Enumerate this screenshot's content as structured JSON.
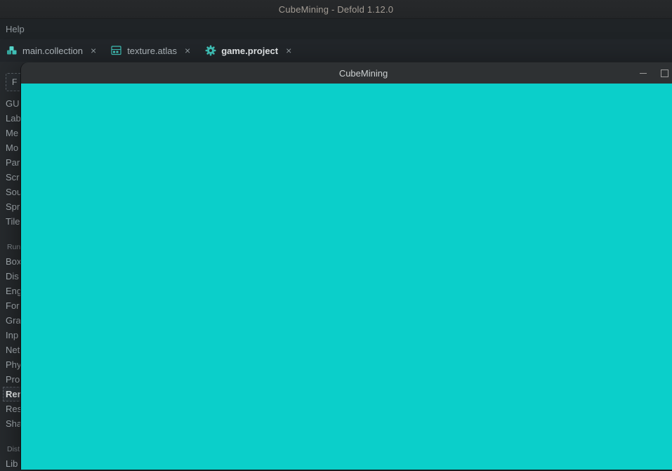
{
  "titlebar": {
    "title": "CubeMining - Defold 1.12.0"
  },
  "menubar": {
    "items": [
      {
        "label": "Help"
      }
    ]
  },
  "tabbar": {
    "tabs": [
      {
        "label": "main.collection",
        "icon": "collection-icon",
        "close_glyph": "×",
        "active": false
      },
      {
        "label": "texture.atlas",
        "icon": "atlas-icon",
        "close_glyph": "×",
        "active": false
      },
      {
        "label": "game.project",
        "icon": "gear-icon",
        "close_glyph": "×",
        "active": true
      }
    ]
  },
  "sidebar": {
    "filter_text": "F",
    "groups": [
      {
        "header": null,
        "selected_index": -1,
        "items": [
          "GU",
          "Lab",
          "Me",
          "Mo",
          "Par",
          "Scr",
          "Sou",
          "Spr",
          "Tile"
        ]
      },
      {
        "header": "Run",
        "selected_index": 9,
        "items": [
          "Box",
          "Dis",
          "Eng",
          "For",
          "Gra",
          "Inp",
          "Net",
          "Phy",
          "Pro",
          "Ren",
          "Res",
          "Sha"
        ]
      },
      {
        "header": "Dist",
        "selected_index": -1,
        "items": [
          "Lib"
        ]
      }
    ]
  },
  "game_window": {
    "title": "CubeMining"
  },
  "colors": {
    "accent_teal": "#41c4ba",
    "game_view": "#0bcfca",
    "game_view_bottom_edge": "#15b9b5",
    "editor_background": "#272b2e",
    "window_titlebar": "#2e3133"
  }
}
